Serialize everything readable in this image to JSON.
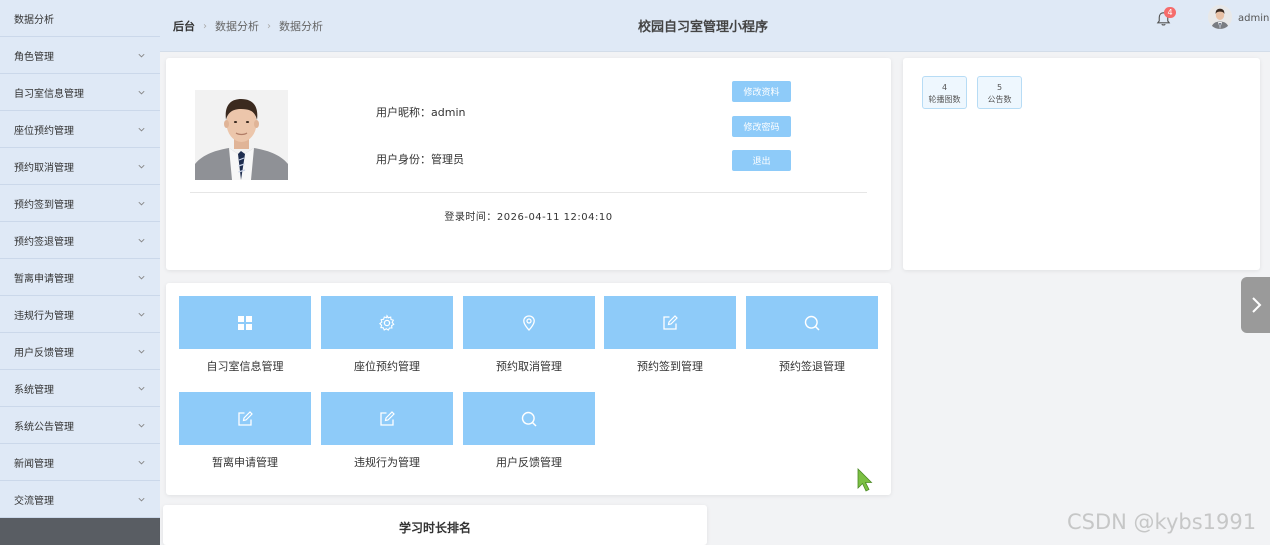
{
  "sidebar": {
    "items": [
      {
        "label": "数据分析",
        "has_chevron": false
      },
      {
        "label": "角色管理",
        "has_chevron": true
      },
      {
        "label": "自习室信息管理",
        "has_chevron": true
      },
      {
        "label": "座位预约管理",
        "has_chevron": true
      },
      {
        "label": "预约取消管理",
        "has_chevron": true
      },
      {
        "label": "预约签到管理",
        "has_chevron": true
      },
      {
        "label": "预约签退管理",
        "has_chevron": true
      },
      {
        "label": "暂离申请管理",
        "has_chevron": true
      },
      {
        "label": "违规行为管理",
        "has_chevron": true
      },
      {
        "label": "用户反馈管理",
        "has_chevron": true
      },
      {
        "label": "系统管理",
        "has_chevron": true
      },
      {
        "label": "系统公告管理",
        "has_chevron": true
      },
      {
        "label": "新闻管理",
        "has_chevron": true
      },
      {
        "label": "交流管理",
        "has_chevron": true
      }
    ]
  },
  "header": {
    "breadcrumb": [
      "后台",
      "数据分析",
      "数据分析"
    ],
    "title": "校园自习室管理小程序",
    "notification_count": "4",
    "username": "admin"
  },
  "profile": {
    "nickname_line": "用户昵称：admin",
    "role_line": "用户身份：管理员",
    "edit_profile_label": "修改资料",
    "change_password_label": "修改密码",
    "logout_label": "退出",
    "login_time": "登录时间：2026-04-11 12:04:10"
  },
  "stats": [
    {
      "value": "4",
      "label": "轮播图数"
    },
    {
      "value": "5",
      "label": "公告数"
    }
  ],
  "tiles": [
    {
      "label": "自习室信息管理",
      "icon": "grid-icon"
    },
    {
      "label": "座位预约管理",
      "icon": "gear-icon"
    },
    {
      "label": "预约取消管理",
      "icon": "location-pin-icon"
    },
    {
      "label": "预约签到管理",
      "icon": "edit-icon"
    },
    {
      "label": "预约签退管理",
      "icon": "search-icon"
    },
    {
      "label": "暂离申请管理",
      "icon": "edit-icon"
    },
    {
      "label": "违规行为管理",
      "icon": "edit-icon"
    },
    {
      "label": "用户反馈管理",
      "icon": "search-icon"
    }
  ],
  "ranking": {
    "title": "学习时长排名"
  },
  "watermark": "CSDN @kybs1991",
  "colors": {
    "sidebar_bg": "#dfe9f6",
    "tile_bg": "#8ecbf9",
    "badge": "#f56c6c",
    "sidebar_bottom": "#595d63"
  }
}
